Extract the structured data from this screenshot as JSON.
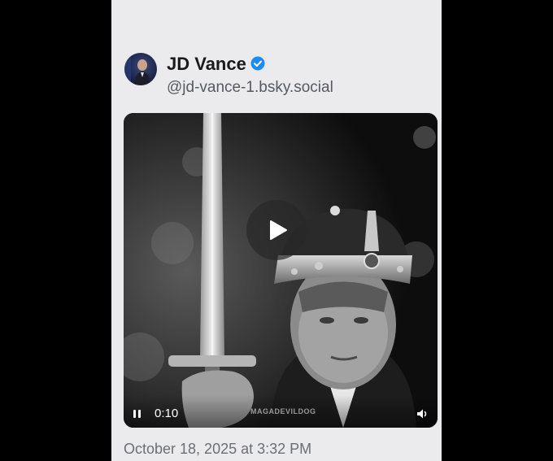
{
  "post": {
    "author": {
      "display_name": "JD Vance",
      "handle": "@jd-vance-1.bsky.social",
      "verified": true,
      "verified_color": "#1d8cf0"
    },
    "video": {
      "elapsed": "0:10",
      "watermark": "MAGADEVILDOG",
      "play_icon": "play-icon",
      "pause_icon": "pause-icon",
      "volume_icon": "volume-icon"
    },
    "timestamp": "October 18, 2025 at 3:32 PM"
  }
}
